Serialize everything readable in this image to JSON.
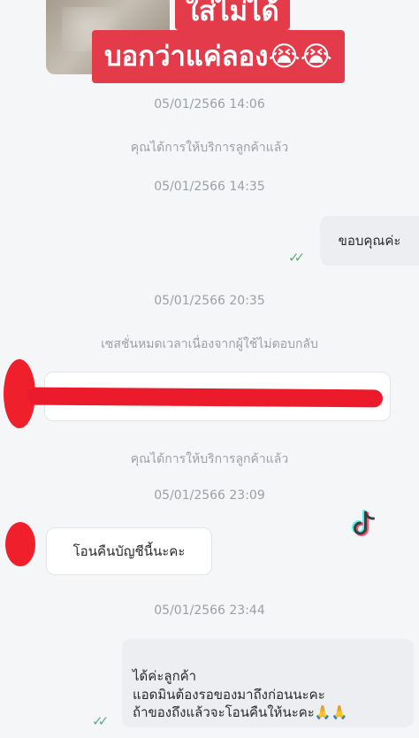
{
  "overlay": {
    "caption_line1": "ใส่ไม่ได้",
    "caption_line2": "บอกว่าแค่ลอง😭😭"
  },
  "messages": [
    {
      "kind": "timestamp",
      "text": "05/01/2566 14:06"
    },
    {
      "kind": "system",
      "text": "คุณได้การให้บริการลูกค้าแล้ว"
    },
    {
      "kind": "timestamp",
      "text": "05/01/2566 14:35"
    },
    {
      "kind": "outgoing",
      "text": "ขอบคุณค่ะ",
      "status_icon": "double-check-icon"
    },
    {
      "kind": "timestamp",
      "text": "05/01/2566 20:35"
    },
    {
      "kind": "system",
      "text": "เซสชั่นหมดเวลาเนื่องจากผู้ใช้ไม่ตอบกลับ"
    },
    {
      "kind": "incoming_redacted"
    },
    {
      "kind": "system",
      "text": "คุณได้การให้บริการลูกค้าแล้ว"
    },
    {
      "kind": "timestamp",
      "text": "05/01/2566 23:09"
    },
    {
      "kind": "incoming",
      "text": "โอนคืนบัญชีนี้นะคะ"
    },
    {
      "kind": "timestamp",
      "text": "05/01/2566 23:44"
    },
    {
      "kind": "outgoing",
      "text": "ได้ค่ะลูกค้า\nแอดมินต้องรอของมาถึงก่อนนะคะ\nถ้าของถึงแล้วจะโอนคืนให้นะคะ🙏🙏",
      "status_icon": "double-check-icon"
    }
  ],
  "watermark": {
    "icon": "tiktok-logo-icon"
  },
  "colors": {
    "caption_bg": "#e33b4a",
    "redaction": "#ec1b2b",
    "read_check": "#5fae7b",
    "system_text": "#9b9fa6"
  }
}
